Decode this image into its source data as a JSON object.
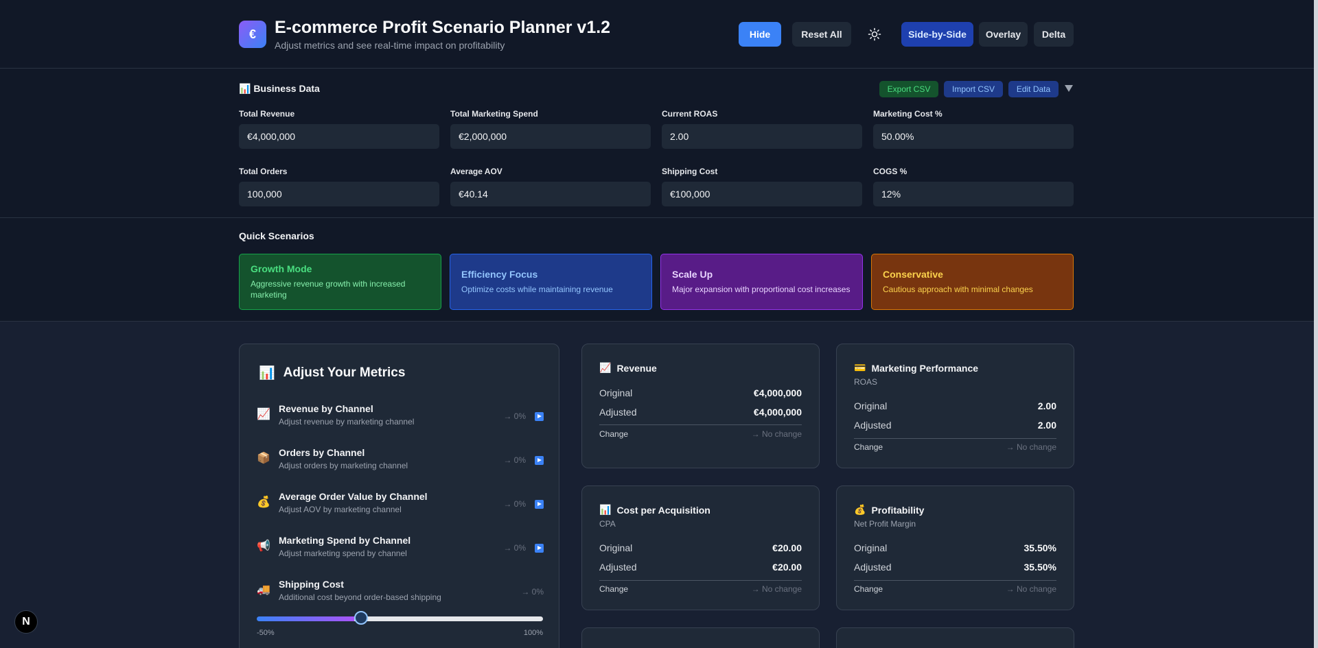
{
  "header": {
    "logo_symbol": "€",
    "title": "E-commerce Profit Scenario Planner v1.2",
    "subtitle": "Adjust metrics and see real-time impact on profitability",
    "hide_label": "Hide",
    "reset_label": "Reset All",
    "theme_icon": "sun-icon",
    "views": [
      "Side-by-Side",
      "Overlay",
      "Delta"
    ],
    "active_view": "Side-by-Side"
  },
  "business": {
    "title": "📊 Business Data",
    "actions": {
      "export": "Export CSV",
      "import": "Import CSV",
      "edit": "Edit Data",
      "collapse_icon": "chevron-down-icon"
    },
    "fields": [
      {
        "label": "Total Revenue",
        "value": "€4,000,000"
      },
      {
        "label": "Total Marketing Spend",
        "value": "€2,000,000"
      },
      {
        "label": "Current ROAS",
        "value": "2.00"
      },
      {
        "label": "Marketing Cost %",
        "value": "50.00%"
      },
      {
        "label": "Total Orders",
        "value": "100,000"
      },
      {
        "label": "Average AOV",
        "value": "€40.14"
      },
      {
        "label": "Shipping Cost",
        "value": "€100,000"
      },
      {
        "label": "COGS %",
        "value": "12%"
      }
    ]
  },
  "scenarios": {
    "title": "Quick Scenarios",
    "items": [
      {
        "name": "Growth Mode",
        "desc": "Aggressive revenue growth with increased marketing",
        "bg": "#14532d",
        "border": "#16a34a",
        "title_color": "#4ade80",
        "desc_color": "#86efac"
      },
      {
        "name": "Efficiency Focus",
        "desc": "Optimize costs while maintaining revenue",
        "bg": "#1e3a8a",
        "border": "#2563eb",
        "title_color": "#93c5fd",
        "desc_color": "#93c5fd"
      },
      {
        "name": "Scale Up",
        "desc": "Major expansion with proportional cost increases",
        "bg": "#581c87",
        "border": "#9333ea",
        "title_color": "#e9d5ff",
        "desc_color": "#e9d5ff"
      },
      {
        "name": "Conservative",
        "desc": "Cautious approach with minimal changes",
        "bg": "#78350f",
        "border": "#d97706",
        "title_color": "#fcd34d",
        "desc_color": "#fcd34d"
      }
    ]
  },
  "metrics": {
    "title": "Adjust Your Metrics",
    "title_icon": "📊",
    "rows": [
      {
        "icon": "📈",
        "title": "Revenue by Channel",
        "desc": "Adjust revenue by marketing channel",
        "pct": "→ 0%"
      },
      {
        "icon": "📦",
        "title": "Orders by Channel",
        "desc": "Adjust orders by marketing channel",
        "pct": "→ 0%"
      },
      {
        "icon": "💰",
        "title": "Average Order Value by Channel",
        "desc": "Adjust AOV by marketing channel",
        "pct": "→ 0%"
      },
      {
        "icon": "📢",
        "title": "Marketing Spend by Channel",
        "desc": "Adjust marketing spend by channel",
        "pct": "→ 0%"
      },
      {
        "icon": "🚚",
        "title": "Shipping Cost",
        "desc": "Additional cost beyond order-based shipping",
        "pct": "→ 0%"
      }
    ],
    "slider": {
      "min_label": "-50%",
      "max_label": "100%",
      "value": 0
    }
  },
  "cards": [
    {
      "icon": "📈",
      "title": "Revenue",
      "sub": "",
      "orig_label": "Original",
      "orig": "€4,000,000",
      "adj_label": "Adjusted",
      "adj": "€4,000,000",
      "chg_label": "Change",
      "chg": "→ No change"
    },
    {
      "icon": "💳",
      "title": "Marketing Performance",
      "sub": "ROAS",
      "orig_label": "Original",
      "orig": "2.00",
      "adj_label": "Adjusted",
      "adj": "2.00",
      "chg_label": "Change",
      "chg": "→ No change"
    },
    {
      "icon": "📊",
      "title": "Cost per Acquisition",
      "sub": "CPA",
      "orig_label": "Original",
      "orig": "€20.00",
      "adj_label": "Adjusted",
      "adj": "€20.00",
      "chg_label": "Change",
      "chg": "→ No change"
    },
    {
      "icon": "💰",
      "title": "Profitability",
      "sub": "Net Profit Margin",
      "orig_label": "Original",
      "orig": "35.50%",
      "adj_label": "Adjusted",
      "adj": "35.50%",
      "chg_label": "Change",
      "chg": "→ No change"
    }
  ],
  "badge": "N"
}
